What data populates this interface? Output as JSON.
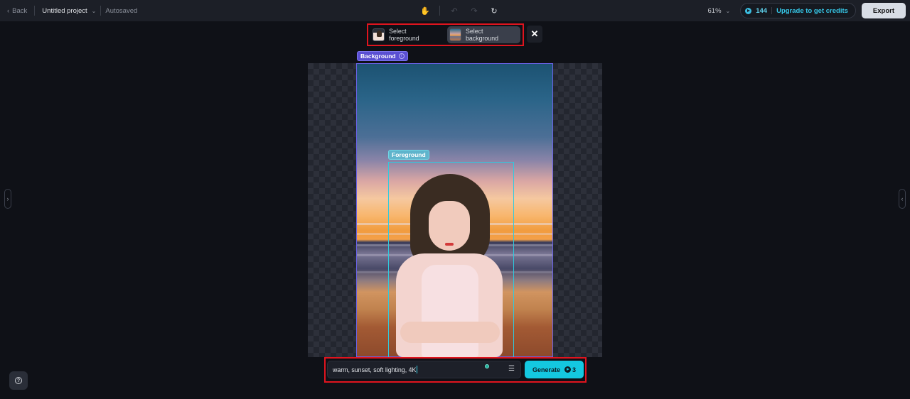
{
  "topbar": {
    "back_label": "Back",
    "project_name": "Untitled project",
    "save_status": "Autosaved",
    "tools": [
      {
        "icon": "hand-icon",
        "glyph": "✋"
      },
      {
        "icon": "undo-icon",
        "glyph": "↶"
      },
      {
        "icon": "redo-icon",
        "glyph": "↷"
      },
      {
        "icon": "refresh-icon",
        "glyph": "↻"
      }
    ],
    "zoom_level": "61%",
    "credits": "144",
    "upgrade_label": "Upgrade to get credits",
    "export_label": "Export"
  },
  "selector": {
    "foreground_label": "Select foreground",
    "background_label": "Select background",
    "active": "background",
    "close_glyph": "✕"
  },
  "canvas": {
    "background_label": "Background",
    "foreground_label": "Foreground",
    "colors": {
      "background_box": "#6a63e8",
      "foreground_box": "#2ecbe0"
    }
  },
  "prompt": {
    "value": "warm, sunset, soft lighting, 4K",
    "generate_label": "Generate",
    "generate_cost": "3",
    "accent": "#14c8e0"
  },
  "sidebars": {
    "left_glyph": "›",
    "right_glyph": "‹"
  },
  "help_glyph": "?"
}
